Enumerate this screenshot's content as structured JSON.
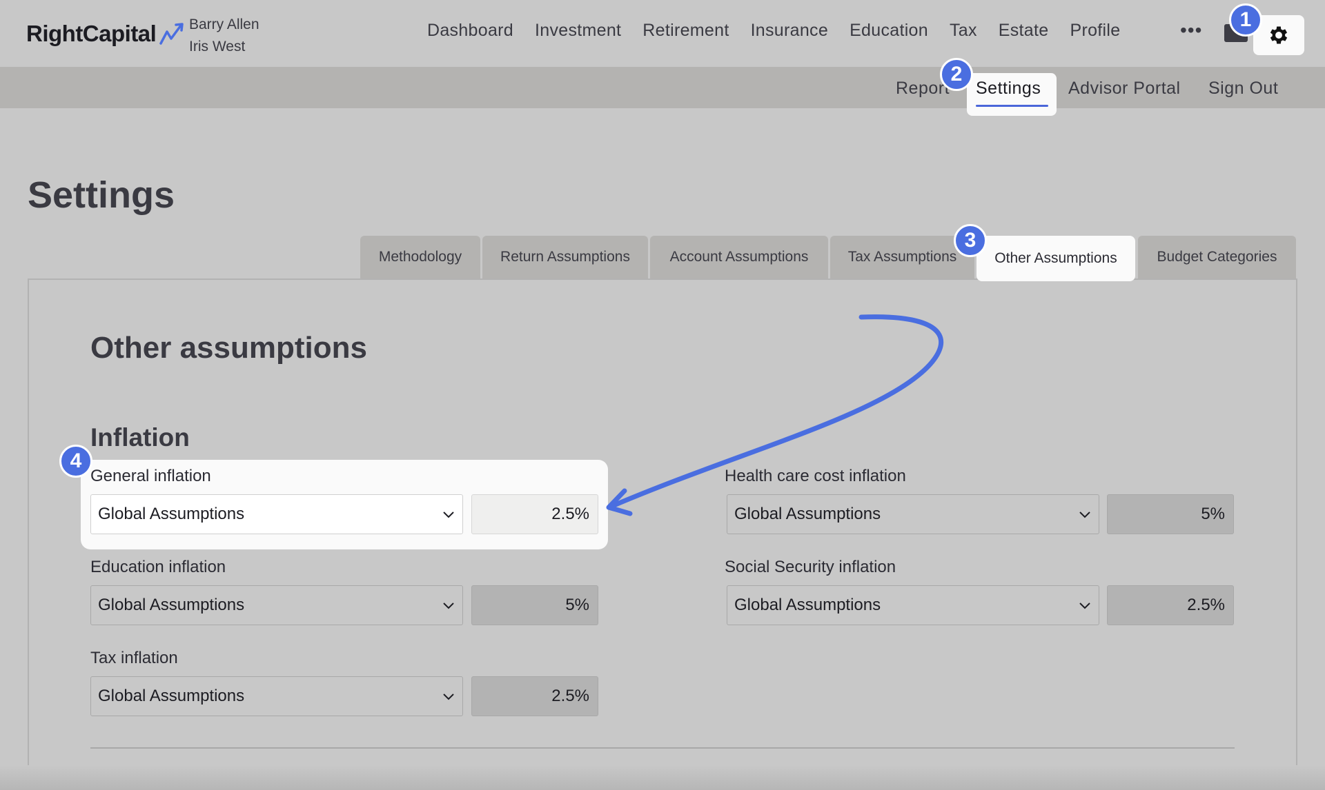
{
  "brand": {
    "name": "RightCapital"
  },
  "clients": [
    "Barry Allen",
    "Iris West"
  ],
  "main_nav": [
    "Dashboard",
    "Investment",
    "Retirement",
    "Insurance",
    "Education",
    "Tax",
    "Estate",
    "Profile"
  ],
  "more_label": "•••",
  "sub_nav": {
    "report": "Report",
    "settings": "Settings",
    "advisor_portal": "Advisor Portal",
    "sign_out": "Sign Out"
  },
  "page_title": "Settings",
  "tabs": [
    "Methodology",
    "Return Assumptions",
    "Account Assumptions",
    "Tax Assumptions",
    "Other Assumptions",
    "Budget Categories"
  ],
  "active_tab": "Other Assumptions",
  "section_title": "Other assumptions",
  "inflation": {
    "title": "Inflation",
    "general": {
      "label": "General inflation",
      "source": "Global Assumptions",
      "value": "2.5%"
    },
    "health": {
      "label": "Health care cost inflation",
      "source": "Global Assumptions",
      "value": "5%"
    },
    "education": {
      "label": "Education inflation",
      "source": "Global Assumptions",
      "value": "5%"
    },
    "social_security": {
      "label": "Social Security inflation",
      "source": "Global Assumptions",
      "value": "2.5%"
    },
    "tax": {
      "label": "Tax inflation",
      "source": "Global Assumptions",
      "value": "2.5%"
    }
  },
  "badges": [
    "1",
    "2",
    "3",
    "4"
  ],
  "colors": {
    "accent": "#4a6ee0",
    "background": "#c8c8c8",
    "subbar": "#b4b3b1"
  },
  "icons": {
    "gear": "gear-icon",
    "folder": "folder-icon",
    "chevron": "chevron-down-icon",
    "logo_mark": "trend-arrow-icon"
  }
}
